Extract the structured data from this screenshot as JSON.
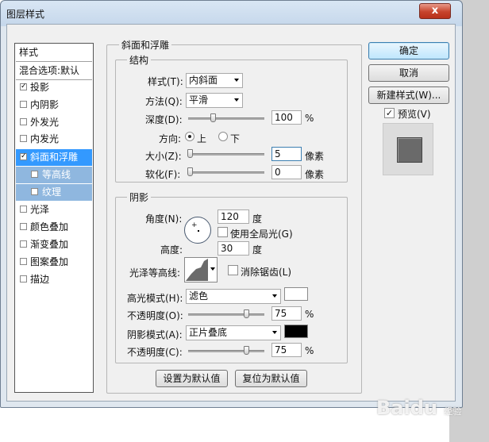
{
  "window": {
    "title": "图层样式",
    "close_glyph": "x"
  },
  "style_list": {
    "header": "样式",
    "blend_default": "混合选项:默认",
    "items": [
      {
        "label": "投影",
        "checked": true
      },
      {
        "label": "内阴影",
        "checked": false
      },
      {
        "label": "外发光",
        "checked": false
      },
      {
        "label": "内发光",
        "checked": false
      },
      {
        "label": "斜面和浮雕",
        "checked": true
      },
      {
        "label": "等高线",
        "checked": false
      },
      {
        "label": "纹理",
        "checked": false
      },
      {
        "label": "光泽",
        "checked": false
      },
      {
        "label": "颜色叠加",
        "checked": false
      },
      {
        "label": "渐变叠加",
        "checked": false
      },
      {
        "label": "图案叠加",
        "checked": false
      },
      {
        "label": "描边",
        "checked": false
      }
    ]
  },
  "bevel": {
    "section_title": "斜面和浮雕",
    "structure": {
      "title": "结构",
      "style_label": "样式(T):",
      "style_value": "内斜面",
      "technique_label": "方法(Q):",
      "technique_value": "平滑",
      "depth_label": "深度(D):",
      "depth_value": "100",
      "depth_unit": "%",
      "direction_label": "方向:",
      "dir_up": "上",
      "dir_down": "下",
      "size_label": "大小(Z):",
      "size_value": "5",
      "size_unit": "像素",
      "soften_label": "软化(F):",
      "soften_value": "0",
      "soften_unit": "像素"
    },
    "shading": {
      "title": "阴影",
      "angle_label": "角度(N):",
      "angle_value": "120",
      "angle_unit": "度",
      "global_light_label": "使用全局光(G)",
      "altitude_label": "高度:",
      "altitude_value": "30",
      "altitude_unit": "度",
      "gloss_label": "光泽等高线:",
      "antialias_label": "消除锯齿(L)",
      "highlight_mode_label": "高光模式(H):",
      "highlight_mode_value": "滤色",
      "highlight_color": "#ffffff",
      "highlight_opacity_label": "不透明度(O):",
      "highlight_opacity_value": "75",
      "highlight_opacity_unit": "%",
      "shadow_mode_label": "阴影模式(A):",
      "shadow_mode_value": "正片叠底",
      "shadow_color": "#000000",
      "shadow_opacity_label": "不透明度(C):",
      "shadow_opacity_value": "75",
      "shadow_opacity_unit": "%"
    },
    "make_default": "设置为默认值",
    "reset_default": "复位为默认值"
  },
  "buttons": {
    "ok": "确定",
    "cancel": "取消",
    "new_style": "新建样式(W)...",
    "preview_label": "预览(V)"
  },
  "watermark": {
    "text": "Baidu",
    "sub": "经验"
  },
  "colors": {
    "selection": "#3399ff",
    "sub_selection": "#8fb7df"
  }
}
